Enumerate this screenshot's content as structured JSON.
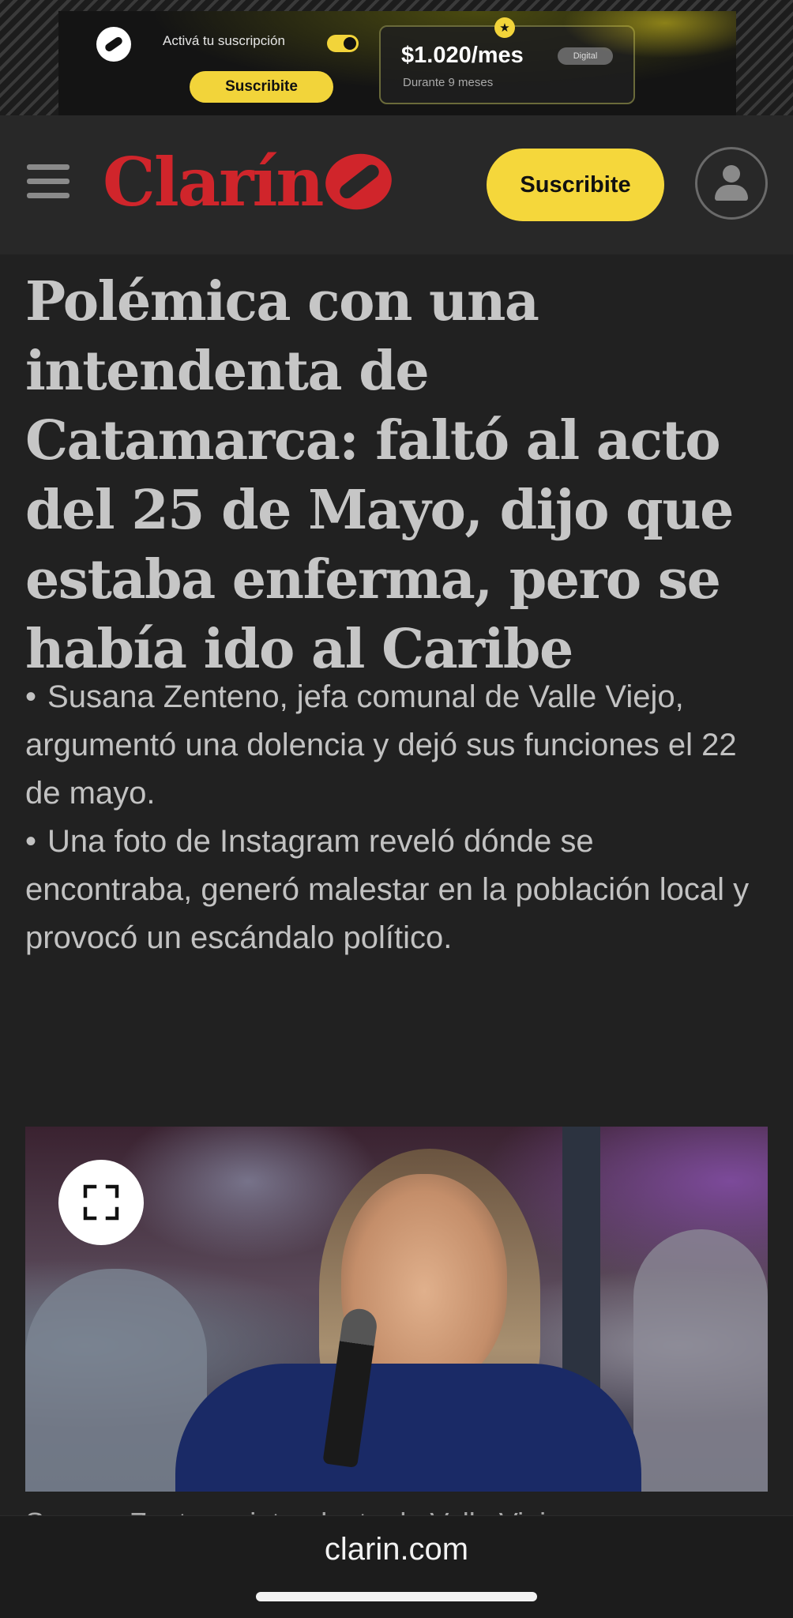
{
  "ad": {
    "prompt": "Activá tu suscripción",
    "button_label": "Suscribite",
    "price": "$1.020/mes",
    "price_note": "Durante 9 meses",
    "badge": "Digital",
    "accent_color": "#f2d43a"
  },
  "header": {
    "logo_text": "Clarín",
    "subscribe_label": "Suscribite",
    "brand_color": "#d0252b",
    "button_color": "#f5d73b"
  },
  "article": {
    "headline": "Polémica con una intendenta de Catamarca: faltó al acto del 25 de Mayo, dijo que estaba enferma, pero se había ido al Caribe",
    "summary": [
      "Susana Zenteno, jefa comunal de Valle Viejo, argumentó una dolencia y dejó sus funciones el 22 de mayo.",
      "Una foto de Instagram reveló dónde se encontraba, generó malestar en la población local y provocó un escándalo político."
    ],
    "caption": "Susana Zenteno, intendente de Valle Viejo"
  },
  "browser": {
    "url": "clarin.com"
  },
  "icons": {
    "menu": "hamburger-menu-icon",
    "user": "user-icon",
    "expand": "expand-icon"
  }
}
